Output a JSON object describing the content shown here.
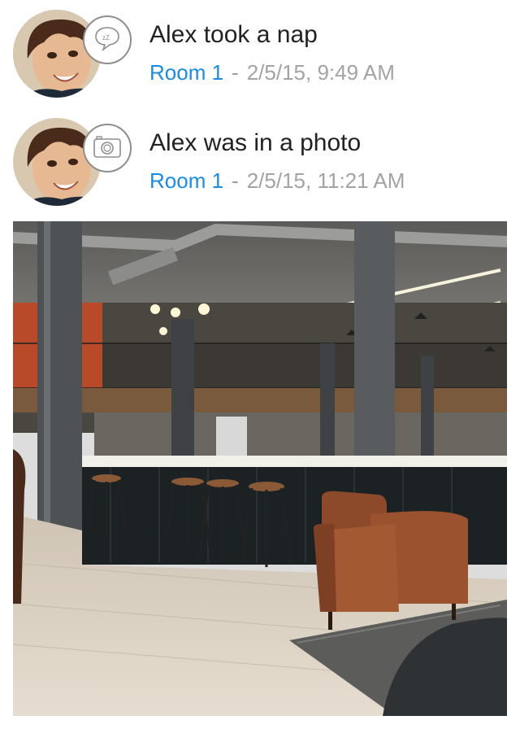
{
  "feed": {
    "items": [
      {
        "title": "Alex took a nap",
        "room": "Room 1",
        "separator": "-",
        "timestamp": "2/5/15, 9:49 AM",
        "badge_icon": "nap-zz-icon"
      },
      {
        "title": "Alex was in a photo",
        "room": "Room 1",
        "separator": "-",
        "timestamp": "2/5/15, 11:21 AM",
        "badge_icon": "camera-icon"
      }
    ],
    "photo": {
      "subject": "cafe-interior-photo"
    }
  },
  "colors": {
    "link_blue": "#1a8ce8",
    "meta_gray": "#a3a3a3",
    "title_text": "#222222"
  }
}
